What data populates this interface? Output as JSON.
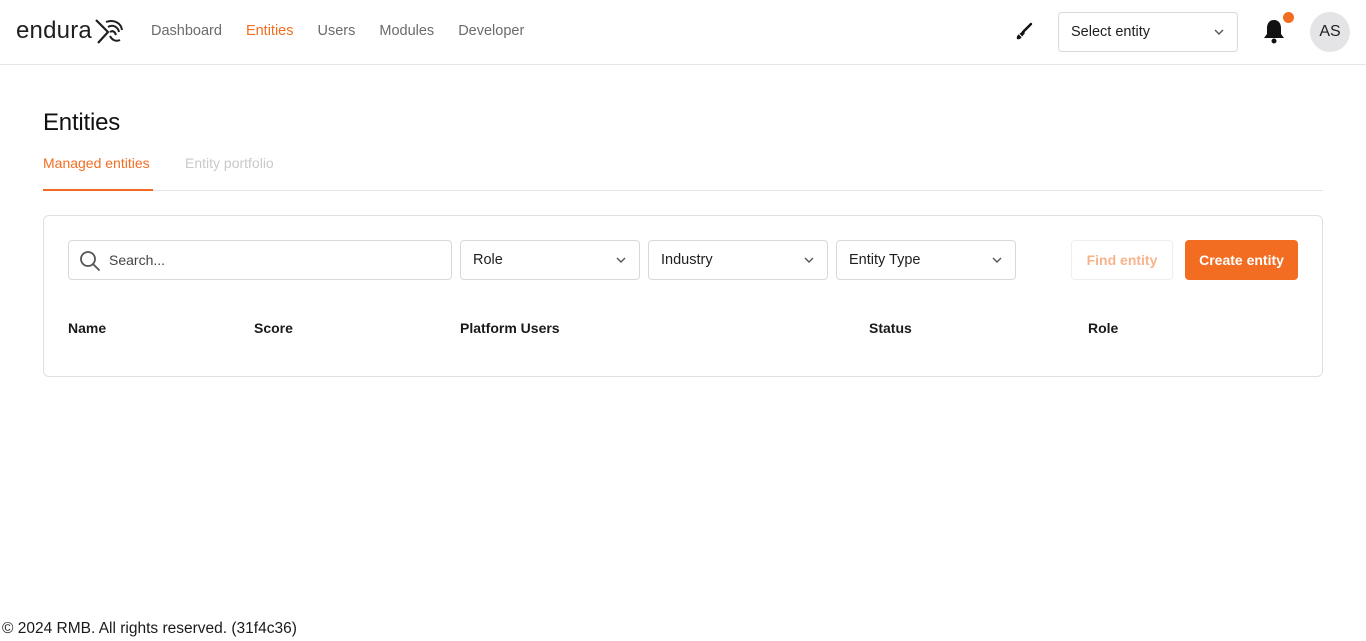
{
  "header": {
    "logo_text": "endura",
    "nav": [
      {
        "label": "Dashboard",
        "active": false
      },
      {
        "label": "Entities",
        "active": true
      },
      {
        "label": "Users",
        "active": false
      },
      {
        "label": "Modules",
        "active": false
      },
      {
        "label": "Developer",
        "active": false
      }
    ],
    "entity_select": "Select entity",
    "avatar_initials": "AS",
    "icons": {
      "theme": "paintbrush-icon",
      "notifications": "bell-icon"
    }
  },
  "page": {
    "title": "Entities",
    "tabs": [
      {
        "label": "Managed entities",
        "active": true
      },
      {
        "label": "Entity portfolio",
        "active": false
      }
    ]
  },
  "filters": {
    "search_placeholder": "Search...",
    "role": "Role",
    "industry": "Industry",
    "entity_type": "Entity Type",
    "find_button": "Find entity",
    "create_button": "Create entity"
  },
  "table": {
    "columns": [
      "Name",
      "Score",
      "Platform Users",
      "Status",
      "Role"
    ]
  },
  "footer": {
    "text": "© 2024 RMB. All rights reserved. (31f4c36)"
  },
  "colors": {
    "accent": "#f26d21",
    "accent_disabled": "#f7b48c"
  }
}
